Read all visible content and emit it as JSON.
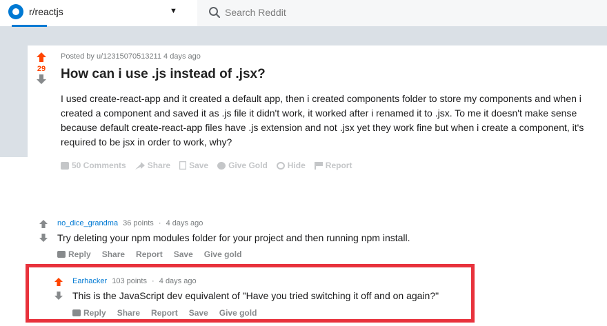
{
  "header": {
    "community": "r/reactjs",
    "community_caret": "▼",
    "search_placeholder": "Search Reddit"
  },
  "post": {
    "vote_count": "29",
    "meta": "Posted by u/12315070513211 4 days ago",
    "title": "How can i use .js instead of .jsx?",
    "body": "I used create-react-app and it created a default app, then i created components folder to store my components and when i created a component and saved it as .js file it didn't work, it worked after i renamed it to .jsx. To me it doesn't make sense because default create-react-app files have .js extension and not .jsx yet they work fine but when i create a component, it's required to be jsx in order to work, why?",
    "actions": {
      "comments": "50 Comments",
      "share": "Share",
      "save": "Save",
      "give_gold": "Give Gold",
      "hide": "Hide",
      "report": "Report"
    }
  },
  "comments": [
    {
      "author": "no_dice_grandma",
      "points": "36 points",
      "separator": "·",
      "time": "4 days ago",
      "body": "Try deleting your npm modules folder for your project and then running npm install.",
      "actions": {
        "reply": "Reply",
        "share": "Share",
        "report": "Report",
        "save": "Save",
        "give_gold": "Give gold"
      }
    },
    {
      "author": "Earhacker",
      "points": "103 points",
      "separator": "·",
      "time": "4 days ago",
      "body": "This is the JavaScript dev equivalent of \"Have you tried switching it off and on again?\"",
      "actions": {
        "reply": "Reply",
        "share": "Share",
        "report": "Report",
        "save": "Save",
        "give_gold": "Give gold"
      }
    }
  ],
  "colors": {
    "upvote": "#ff4500",
    "link": "#0079d3",
    "highlight_border": "#e8323c",
    "background": "#dae0e6"
  }
}
